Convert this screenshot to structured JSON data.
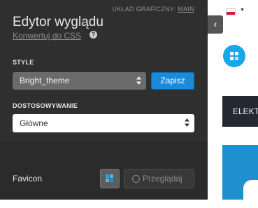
{
  "editor": {
    "layout_label": "UKŁAD GRAFICZNY:",
    "layout_value": "MAIN",
    "title": "Edytor wyglądu",
    "convert_link": "Konwertuj do CSS",
    "style_section": "STYLE",
    "theme_select": "Bright_theme",
    "save_button": "Zapisz",
    "customize_section": "DOSTOSOWYWANIE",
    "customize_select": "Główne",
    "favicon_label": "Favicon",
    "browse_button": "Przeglądaj"
  },
  "preview": {
    "collapse_icon": "chevron-left-icon",
    "nav_text": "ELEKT",
    "language_flag": "flag-poland-icon",
    "brand_color": "#1aa7e8",
    "nav_color": "#232a33",
    "banner_color": "#1e8fcf"
  }
}
